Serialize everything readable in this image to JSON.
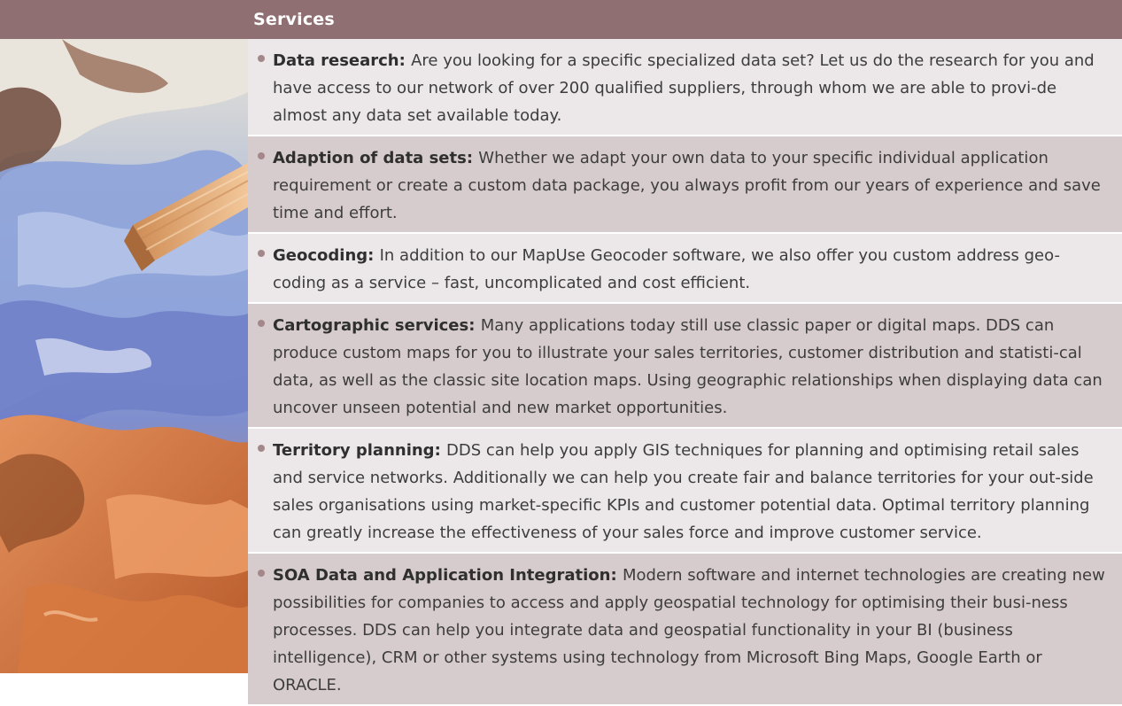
{
  "header": {
    "title": "Services"
  },
  "image": {
    "icon": "oil-paint-palette-knife-image"
  },
  "colors": {
    "header_band": "#8f6f71",
    "row_light": "#ece7e8",
    "row_dark": "#d7cccd",
    "bullet": "#a3878a",
    "text": "#3d3d3d"
  },
  "services": [
    {
      "title": "Data research:",
      "text": "Are you looking for a specific specialized data set? Let us do the research for you and have access to our network of over 200 qualified suppliers, through whom we are able to provi-de almost any data set available today."
    },
    {
      "title": "Adaption of data sets:",
      "text": "Whether we adapt your own data to your specific individual application requirement or create a custom data package, you always profit from our years of experience and save time and effort."
    },
    {
      "title": "Geocoding:",
      "text": "In addition to our MapUse Geocoder software, we also offer you custom address geo-coding as a service – fast, uncomplicated and cost efficient."
    },
    {
      "title": "Cartographic services:",
      "text": "Many applications today still use classic paper or digital maps. DDS can produce custom maps for you to illustrate your sales territories, customer distribution and statisti-cal data, as well as the classic site location maps. Using geographic relationships when displaying data can uncover unseen potential and new market opportunities."
    },
    {
      "title": "Territory planning:",
      "text": "DDS can help you apply GIS techniques for planning and optimising retail sales and service networks. Additionally we can help you create fair and balance territories for your out-side sales organisations using market-specific KPIs and customer potential data. Optimal territory planning can greatly increase the effectiveness of your sales force and improve customer service."
    },
    {
      "title": "SOA Data and Application Integration:",
      "text": "Modern software and internet technologies are creating new possibilities for companies to access and apply geospatial technology for optimising their busi-ness processes. DDS can help you integrate data and geospatial functionality in your BI (business intelligence), CRM or other systems using technology from Microsoft Bing Maps, Google Earth or ORACLE."
    }
  ]
}
